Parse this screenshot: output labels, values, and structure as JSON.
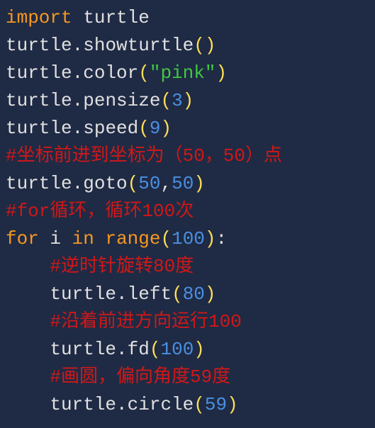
{
  "lines": [
    {
      "tokens": [
        {
          "text": "import"
        },
        {
          "text": "turtle"
        }
      ]
    },
    {
      "tokens": [
        {
          "text": "turtle"
        },
        {
          "text": "."
        },
        {
          "text": "showturtle"
        },
        {
          "text": "("
        },
        {
          "text": ")"
        }
      ]
    },
    {
      "tokens": [
        {
          "text": "turtle"
        },
        {
          "text": "."
        },
        {
          "text": "color"
        },
        {
          "text": "("
        },
        {
          "text": "\"pink\""
        },
        {
          "text": ")"
        }
      ]
    },
    {
      "tokens": [
        {
          "text": "turtle"
        },
        {
          "text": "."
        },
        {
          "text": "pensize"
        },
        {
          "text": "("
        },
        {
          "text": "3"
        },
        {
          "text": ")"
        }
      ]
    },
    {
      "tokens": [
        {
          "text": "turtle"
        },
        {
          "text": "."
        },
        {
          "text": "speed"
        },
        {
          "text": "("
        },
        {
          "text": "9"
        },
        {
          "text": ")"
        }
      ]
    },
    {
      "tokens": [
        {
          "text": "#坐标前进到坐标为（50，50）点"
        }
      ]
    },
    {
      "tokens": [
        {
          "text": "turtle"
        },
        {
          "text": "."
        },
        {
          "text": "goto"
        },
        {
          "text": "("
        },
        {
          "text": "50"
        },
        {
          "text": ","
        },
        {
          "text": "50"
        },
        {
          "text": ")"
        }
      ]
    },
    {
      "tokens": [
        {
          "text": "#for循环，循环100次"
        }
      ]
    },
    {
      "tokens": [
        {
          "text": "for"
        },
        {
          "text": "i"
        },
        {
          "text": "in"
        },
        {
          "text": "range"
        },
        {
          "text": "("
        },
        {
          "text": "100"
        },
        {
          "text": ")"
        },
        {
          "text": ":"
        }
      ]
    },
    {
      "tokens": [
        {
          "text": "#逆时针旋转80度"
        }
      ]
    },
    {
      "tokens": [
        {
          "text": "turtle"
        },
        {
          "text": "."
        },
        {
          "text": "left"
        },
        {
          "text": "("
        },
        {
          "text": "80"
        },
        {
          "text": ")"
        }
      ]
    },
    {
      "tokens": [
        {
          "text": "#沿着前进方向运行100"
        }
      ]
    },
    {
      "tokens": [
        {
          "text": "turtle"
        },
        {
          "text": "."
        },
        {
          "text": "fd"
        },
        {
          "text": "("
        },
        {
          "text": "100"
        },
        {
          "text": ")"
        }
      ]
    },
    {
      "tokens": [
        {
          "text": "#画圆，偏向角度59度"
        }
      ]
    },
    {
      "tokens": [
        {
          "text": "turtle"
        },
        {
          "text": "."
        },
        {
          "text": "circle"
        },
        {
          "text": "("
        },
        {
          "text": "59"
        },
        {
          "text": ")"
        }
      ]
    }
  ]
}
